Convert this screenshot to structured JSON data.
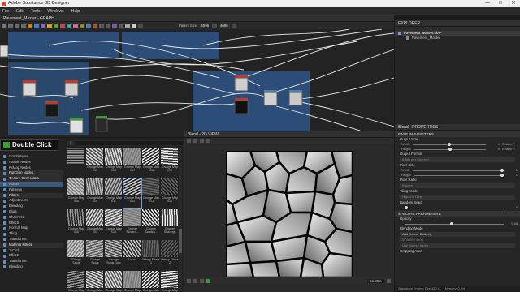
{
  "window": {
    "title": "Adobe Substance 3D Designer",
    "controls": [
      "—",
      "□",
      "✕"
    ]
  },
  "menu": [
    "File",
    "Edit",
    "Tools",
    "Windows",
    "Help"
  ],
  "graph": {
    "tab": "Pavement_Master - GRAPH",
    "parent_size_label": "Parent Size:",
    "size1": "4096",
    "size2": "4096"
  },
  "explorer": {
    "title": "EXPLORER",
    "package": "Pavement_Master.sbs*",
    "graph_item": "Pavement_Master"
  },
  "tooltip": "Double Click",
  "library": {
    "search_placeholder": "",
    "categories": [
      {
        "label": "Graph Items",
        "hdr": false
      },
      {
        "label": "Atomic Nodes",
        "hdr": false
      },
      {
        "label": "FxMap Nodes",
        "hdr": false
      },
      {
        "label": "Function Nodes",
        "hdr": true
      },
      {
        "label": "Texture Generators",
        "hdr": true
      },
      {
        "label": "Noises",
        "hdr": false,
        "sel": true
      },
      {
        "label": "Patterns",
        "hdr": false
      },
      {
        "label": "Filters",
        "hdr": true
      },
      {
        "label": "Adjustments",
        "hdr": false
      },
      {
        "label": "Blending",
        "hdr": false
      },
      {
        "label": "Blurs",
        "hdr": false
      },
      {
        "label": "Channels",
        "hdr": false
      },
      {
        "label": "Effects",
        "hdr": false
      },
      {
        "label": "Normal Map",
        "hdr": false
      },
      {
        "label": "Tiling",
        "hdr": false
      },
      {
        "label": "Transforms",
        "hdr": false
      },
      {
        "label": "Material Filters",
        "hdr": true
      },
      {
        "label": "1-Click",
        "hdr": false
      },
      {
        "label": "Effects",
        "hdr": false
      },
      {
        "label": "Transforms",
        "hdr": false
      },
      {
        "label": "Blending",
        "hdr": false
      }
    ],
    "thumbnails": [
      "",
      "Grunge Map 002",
      "Grunge Map 005",
      "Grunge Map 007",
      "Grunge Map 008",
      "Grunge Map 009",
      "Grunge Map 006",
      "Grunge Map 010",
      "Grunge Map 011",
      "Grunge Map 012",
      "Grunge Map 013",
      "Grunge Map 014",
      "Grunge Map 016",
      "Grunge Map 001",
      "Grunge Map 015",
      "Grunge Scratch...",
      "Grunge Scratch...",
      "Grunge Shavings",
      "Grunge Spots",
      "Grunge Spots",
      "Grunge Spots Dirty",
      "Liquid",
      "Messy Fibers 1",
      "Messy Fibers 2",
      "Grunge Map 017",
      "Grunge Map 018",
      "Grunge Map 019",
      "Grunge Map 020",
      "Grunge Map 021",
      "Grunge Map 022"
    ]
  },
  "view2d": {
    "tab": "Blend - 2D VIEW",
    "zoom": "51.36%",
    "footer": ""
  },
  "properties": {
    "title": "Blend - PROPERTIES",
    "base_section": "BASE PARAMETERS",
    "output_size": "Output Size",
    "width": "Width",
    "height": "Height",
    "width_val": "0",
    "height_val": "0",
    "width_rel": "Relat to P.",
    "height_rel": "Relat to P.",
    "output_format": "Output Format",
    "output_format_val": "8 Bits per Channel",
    "pixel_size": "Pixel Size",
    "px_width_val": "1",
    "px_height_val": "1",
    "pixel_ratio": "Pixel Ratio",
    "pixel_ratio_val": "Square",
    "tiling_mode": "Tiling Mode",
    "tiling_mode_val": "H and V Tiling",
    "random_seed": "Random Seed",
    "random_seed_val": "0",
    "specific_section": "SPECIFIC PARAMETERS",
    "opacity": "Opacity",
    "opacity_val": "0.48",
    "blending_mode": "Blending Mode",
    "blending_mode_val": "Add (Linear Dodge)",
    "alpha_blending": "Alpha Blending",
    "alpha_blending_val": "Use Source Alpha",
    "cropping_area": "Cropping Area"
  },
  "status": {
    "engine": "Substance Engine: Direct3D 11",
    "memory": "Memory: 0.0%"
  },
  "colors": {
    "accent": "#3d6ea8",
    "frame": "#2e588c",
    "node_red": "#c0392b",
    "node_green": "#3a9d3a"
  }
}
